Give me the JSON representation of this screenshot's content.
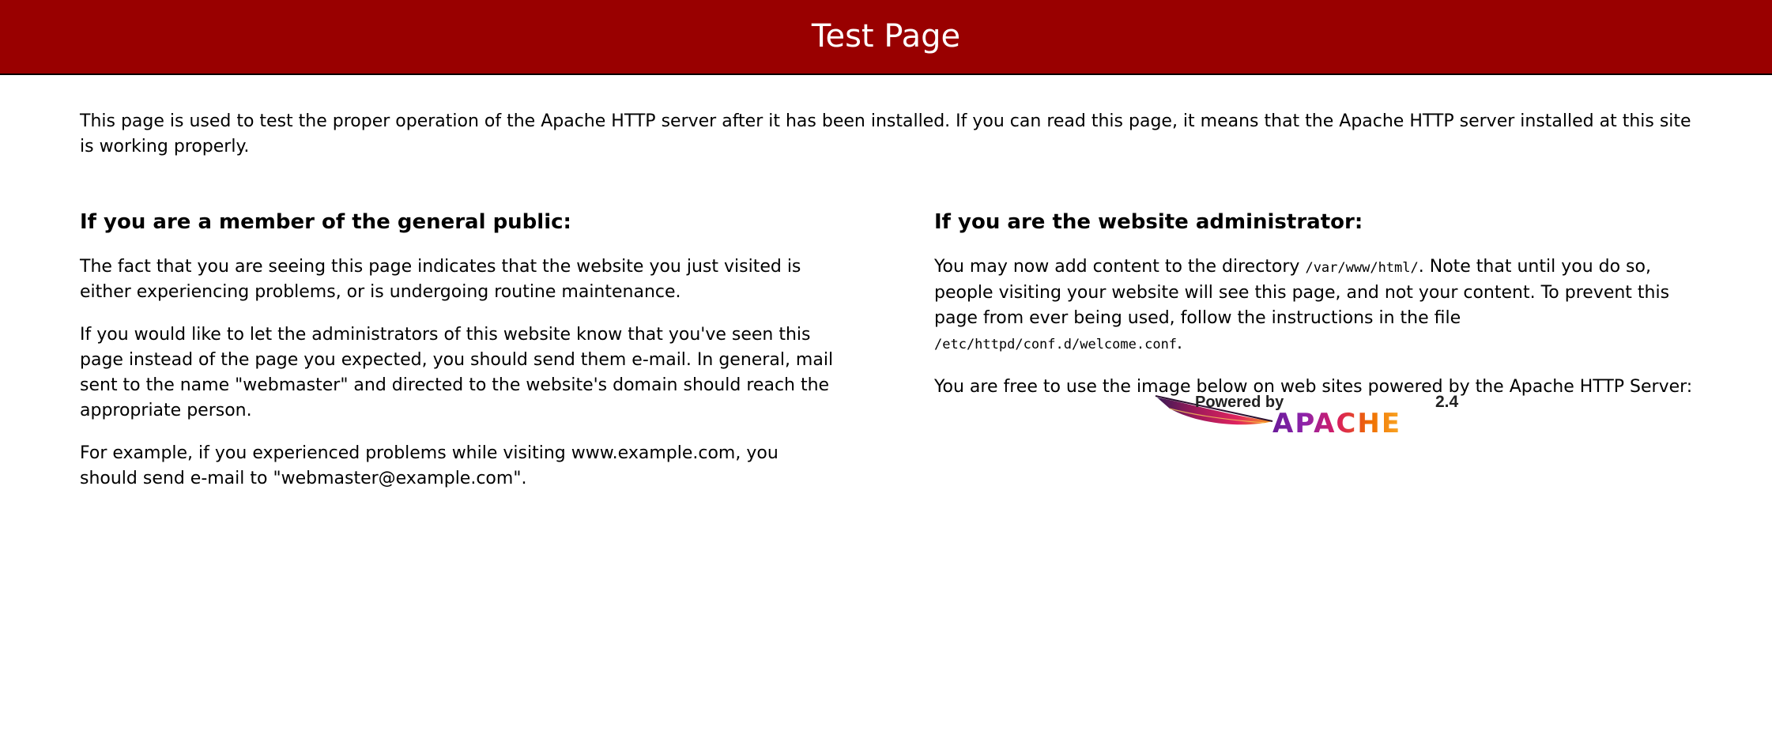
{
  "header": {
    "title": "Test Page"
  },
  "intro": "This page is used to test the proper operation of the Apache HTTP server after it has been installed. If you can read this page, it means that the Apache HTTP server installed at this site is working properly.",
  "public_section": {
    "heading": "If you are a member of the general public:",
    "paragraphs": [
      "The fact that you are seeing this page indicates that the website you just visited is either experiencing problems, or is undergoing routine maintenance.",
      "If you would like to let the administrators of this website know that you've seen this page instead of the page you expected, you should send them e-mail. In general, mail sent to the name \"webmaster\" and directed to the website's domain should reach the appropriate person.",
      "For example, if you experienced problems while visiting www.example.com, you should send e-mail to \"webmaster@example.com\"."
    ]
  },
  "admin_section": {
    "heading": "If you are the website administrator:",
    "p1_part1": "You may now add content to the directory ",
    "p1_code1": "/var/www/html/",
    "p1_part2": ". Note that until you do so, people visiting your website will see this page, and not your content. To prevent this page from ever being used, follow the instructions in the file ",
    "p1_code2": "/etc/httpd/conf.d/welcome.conf",
    "p1_part3": ".",
    "p2": "You are free to use the image below on web sites powered by the Apache HTTP Server:"
  },
  "badge": {
    "powered_by": "Powered by",
    "name": "APACHE",
    "version": "2.4"
  },
  "colors": {
    "header_bg": "#990000",
    "header_text": "#ffffff",
    "apache_gradient_start": "#6a1b9a",
    "apache_gradient_end": "#f57c00"
  }
}
